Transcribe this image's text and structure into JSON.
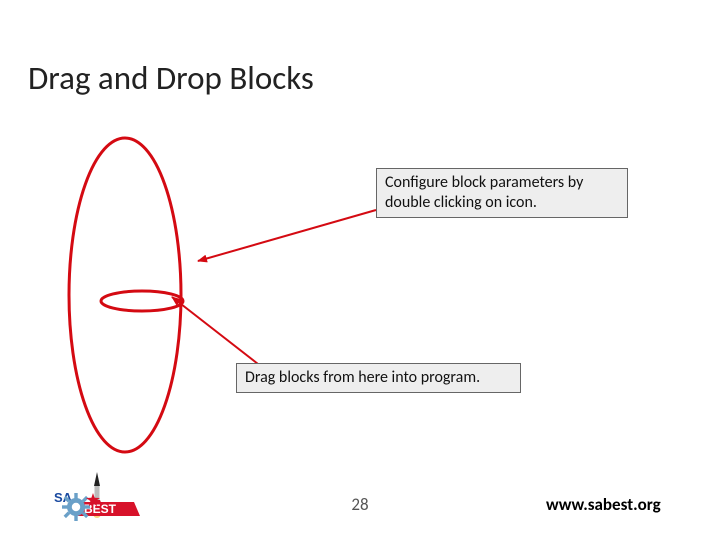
{
  "title": "Drag and Drop Blocks",
  "callouts": {
    "configure": "Configure block parameters by double clicking on icon.",
    "drag": "Drag blocks from here into program."
  },
  "footer": {
    "page": "28",
    "url": "www.sabest.org"
  },
  "colors": {
    "accent_red": "#d40a12",
    "logo_blue": "#1a4aa0",
    "logo_red": "#d7122a",
    "gear_blue": "#6aa0c8"
  }
}
